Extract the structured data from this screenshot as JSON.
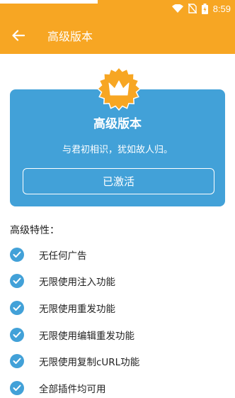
{
  "status_bar": {
    "time": "8:59",
    "icons": [
      "wifi-icon",
      "no-sim-icon",
      "battery-icon"
    ]
  },
  "toolbar": {
    "title": "高级版本",
    "back_icon": "arrow-left-icon"
  },
  "card": {
    "badge_icon": "crown-badge-icon",
    "title": "高级版本",
    "subtitle": "与君初相识，犹如故人归。",
    "button_label": "已激活"
  },
  "features": {
    "heading": "高级特性：",
    "items": [
      {
        "label": "无任何广告"
      },
      {
        "label": "无限使用注入功能"
      },
      {
        "label": "无限使用重发功能"
      },
      {
        "label": "无限使用编辑重发功能"
      },
      {
        "label": "无限使用复制cURL功能"
      },
      {
        "label": "全部插件均可用"
      }
    ]
  },
  "colors": {
    "accent": "#f7a623",
    "card": "#42a1d8",
    "check": "#42a1d8"
  }
}
